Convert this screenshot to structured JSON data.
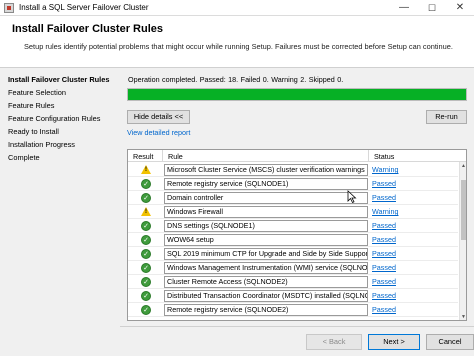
{
  "window": {
    "title": "Install a SQL Server Failover Cluster",
    "controls": {
      "minimize": "—",
      "maximize": "☐",
      "close": "✕"
    }
  },
  "header": {
    "title": "Install Failover Cluster Rules",
    "description": "Setup rules identify potential problems that might occur while running Setup. Failures must be corrected before Setup can continue."
  },
  "sidebar": {
    "items": [
      {
        "label": "Install Failover Cluster Rules",
        "active": true
      },
      {
        "label": "Feature Selection",
        "active": false
      },
      {
        "label": "Feature Rules",
        "active": false
      },
      {
        "label": "Feature Configuration Rules",
        "active": false
      },
      {
        "label": "Ready to Install",
        "active": false
      },
      {
        "label": "Installation Progress",
        "active": false
      },
      {
        "label": "Complete",
        "active": false
      }
    ]
  },
  "main": {
    "summary": "Operation completed.  Passed: 18.   Failed 0.   Warning 2.   Skipped 0.",
    "progress": 1.0,
    "progress_color": "#06b025",
    "hide_details_label": "Hide details <<",
    "rerun_label": "Re-run",
    "view_report_label": "View detailed report",
    "grid": {
      "columns": {
        "result": "Result",
        "rule": "Rule",
        "status": "Status"
      },
      "rows": [
        {
          "icon": "warning-icon",
          "rule": "Microsoft Cluster Service (MSCS) cluster verification warnings",
          "status": "Warning"
        },
        {
          "icon": "passed-icon",
          "rule": "Remote registry service (SQLNODE1)",
          "status": "Passed"
        },
        {
          "icon": "passed-icon",
          "rule": "Domain controller",
          "status": "Passed"
        },
        {
          "icon": "warning-icon",
          "rule": "Windows Firewall",
          "status": "Warning"
        },
        {
          "icon": "passed-icon",
          "rule": "DNS settings (SQLNODE1)",
          "status": "Passed"
        },
        {
          "icon": "passed-icon",
          "rule": "WOW64 setup",
          "status": "Passed"
        },
        {
          "icon": "passed-icon",
          "rule": "SQL 2019 minimum CTP for Upgrade and Side by Side Support",
          "status": "Passed"
        },
        {
          "icon": "passed-icon",
          "rule": "Windows Management Instrumentation (WMI) service (SQLNODE...",
          "status": "Passed"
        },
        {
          "icon": "passed-icon",
          "rule": "Cluster Remote Access (SQLNODE2)",
          "status": "Passed"
        },
        {
          "icon": "passed-icon",
          "rule": "Distributed Transaction Coordinator (MSDTC) installed (SQLNO...",
          "status": "Passed"
        },
        {
          "icon": "passed-icon",
          "rule": "Remote registry service (SQLNODE2)",
          "status": "Passed"
        }
      ]
    }
  },
  "footer": {
    "back_label": "< Back",
    "next_label": "Next >",
    "cancel_label": "Cancel"
  },
  "colors": {
    "link": "#0066cc",
    "passed": "#3f9b3c",
    "warning": "#f2c200"
  }
}
